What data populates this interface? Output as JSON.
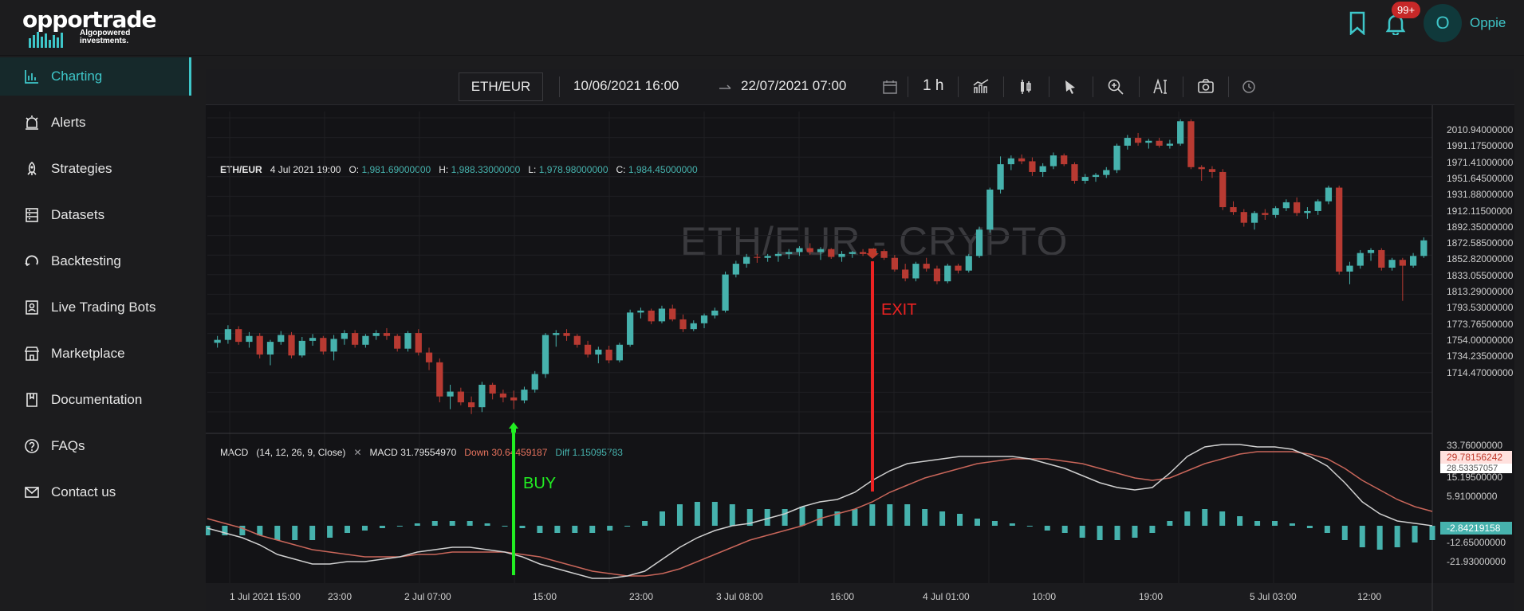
{
  "brand": {
    "name": "opportrade",
    "tagline_line1": "Algopowered",
    "tagline_line2": "investments."
  },
  "header": {
    "notification_count": "99+",
    "avatar_initial": "O",
    "username": "Oppie"
  },
  "sidebar": {
    "items": [
      {
        "label": "Charting",
        "icon": "chart-icon",
        "active": true
      },
      {
        "label": "Alerts",
        "icon": "alarm-icon",
        "active": false
      },
      {
        "label": "Strategies",
        "icon": "rocket-icon",
        "active": false
      },
      {
        "label": "Datasets",
        "icon": "database-icon",
        "active": false
      },
      {
        "label": "Backtesting",
        "icon": "history-icon",
        "active": false
      },
      {
        "label": "Live Trading Bots",
        "icon": "bot-icon",
        "active": false
      },
      {
        "label": "Marketplace",
        "icon": "store-icon",
        "active": false
      },
      {
        "label": "Documentation",
        "icon": "document-icon",
        "active": false
      },
      {
        "label": "FAQs",
        "icon": "question-icon",
        "active": false
      },
      {
        "label": "Contact us",
        "icon": "mail-icon",
        "active": false
      }
    ]
  },
  "toolbar": {
    "symbol": "ETH/EUR",
    "start_date": "10/06/2021 16:00",
    "end_date": "22/07/2021 07:00",
    "interval": "1 h"
  },
  "chart": {
    "watermark": "ETH/EUR - CRYPTO",
    "ohlc": {
      "symbol": "ETH/EUR",
      "time": "4 Jul 2021 19:00",
      "o_label": "O:",
      "o": "1,981.69000000",
      "h_label": "H:",
      "h": "1,988.33000000",
      "l_label": "L:",
      "l": "1,978.98000000",
      "c_label": "C:",
      "c": "1,984.45000000"
    },
    "macd_legend": {
      "name": "MACD",
      "params": "(14, 12, 26, 9, Close)",
      "macd_label": "MACD",
      "macd_value": "31.79554970",
      "down_label": "Down",
      "down_value": "30.64459187",
      "diff_label": "Diff",
      "diff_value": "1.15095783"
    },
    "annotations": {
      "buy": "BUY",
      "exit": "EXIT"
    },
    "price_ticks": [
      "2010.94000000",
      "1991.17500000",
      "1971.41000000",
      "1951.64500000",
      "1931.88000000",
      "1912.11500000",
      "1892.35000000",
      "1872.58500000",
      "1852.82000000",
      "1833.05500000",
      "1813.29000000",
      "1793.53000000",
      "1773.76500000",
      "1754.00000000",
      "1734.23500000",
      "1714.47000000"
    ],
    "macd_ticks": [
      "33.76000000",
      "15.19500000",
      "5.91000000",
      "-12.65000000",
      "-21.93000000"
    ],
    "macd_tags": {
      "macd": "29.78156242",
      "signal": "28.53357057",
      "hist": "-2.84219158"
    },
    "time_ticks": [
      "1 Jul 2021 15:00",
      "23:00",
      "2 Jul 07:00",
      "15:00",
      "23:00",
      "3 Jul 08:00",
      "16:00",
      "4 Jul 01:00",
      "10:00",
      "19:00",
      "5 Jul 03:00",
      "12:00"
    ],
    "colors": {
      "up": "#46b2ad",
      "down": "#b83a32",
      "macd_line": "#d0d0d0",
      "signal_line": "#c9665a",
      "buy_marker": "#22ee22",
      "exit_marker": "#ee2222"
    }
  },
  "chart_data": {
    "type": "candlestick",
    "title": "",
    "xlabel": "",
    "ylabel": "",
    "ylim": [
      1700,
      2020
    ],
    "candles": [
      [
        1783,
        1790,
        1778,
        1786
      ],
      [
        1786,
        1801,
        1782,
        1797
      ],
      [
        1797,
        1800,
        1781,
        1784
      ],
      [
        1784,
        1794,
        1778,
        1790
      ],
      [
        1790,
        1793,
        1767,
        1771
      ],
      [
        1771,
        1786,
        1760,
        1784
      ],
      [
        1784,
        1795,
        1781,
        1791
      ],
      [
        1791,
        1794,
        1767,
        1770
      ],
      [
        1770,
        1789,
        1768,
        1785
      ],
      [
        1785,
        1792,
        1780,
        1788
      ],
      [
        1788,
        1790,
        1771,
        1774
      ],
      [
        1774,
        1791,
        1765,
        1787
      ],
      [
        1787,
        1796,
        1781,
        1793
      ],
      [
        1793,
        1796,
        1778,
        1781
      ],
      [
        1781,
        1792,
        1778,
        1790
      ],
      [
        1790,
        1796,
        1786,
        1793
      ],
      [
        1793,
        1798,
        1786,
        1790
      ],
      [
        1790,
        1792,
        1774,
        1777
      ],
      [
        1777,
        1795,
        1774,
        1793
      ],
      [
        1793,
        1797,
        1770,
        1773
      ],
      [
        1773,
        1778,
        1755,
        1763
      ],
      [
        1763,
        1767,
        1722,
        1728
      ],
      [
        1728,
        1740,
        1715,
        1733
      ],
      [
        1733,
        1737,
        1719,
        1722
      ],
      [
        1722,
        1728,
        1710,
        1717
      ],
      [
        1717,
        1743,
        1712,
        1740
      ],
      [
        1740,
        1742,
        1725,
        1731
      ],
      [
        1731,
        1735,
        1722,
        1727
      ],
      [
        1727,
        1734,
        1715,
        1724
      ],
      [
        1724,
        1738,
        1721,
        1735
      ],
      [
        1735,
        1754,
        1732,
        1751
      ],
      [
        1751,
        1793,
        1747,
        1791
      ],
      [
        1791,
        1796,
        1779,
        1793
      ],
      [
        1793,
        1797,
        1785,
        1790
      ],
      [
        1790,
        1792,
        1778,
        1781
      ],
      [
        1781,
        1785,
        1768,
        1771
      ],
      [
        1771,
        1779,
        1762,
        1776
      ],
      [
        1776,
        1780,
        1762,
        1765
      ],
      [
        1765,
        1783,
        1763,
        1781
      ],
      [
        1781,
        1817,
        1779,
        1814
      ],
      [
        1814,
        1819,
        1808,
        1816
      ],
      [
        1816,
        1818,
        1802,
        1805
      ],
      [
        1805,
        1821,
        1803,
        1818
      ],
      [
        1818,
        1822,
        1805,
        1807
      ],
      [
        1807,
        1812,
        1794,
        1797
      ],
      [
        1797,
        1806,
        1795,
        1803
      ],
      [
        1803,
        1813,
        1798,
        1811
      ],
      [
        1811,
        1819,
        1808,
        1816
      ],
      [
        1816,
        1856,
        1814,
        1853
      ],
      [
        1853,
        1867,
        1850,
        1864
      ],
      [
        1864,
        1874,
        1860,
        1871
      ],
      [
        1871,
        1874,
        1865,
        1870
      ],
      [
        1870,
        1874,
        1866,
        1872
      ],
      [
        1872,
        1876,
        1866,
        1874
      ],
      [
        1874,
        1879,
        1869,
        1876
      ],
      [
        1876,
        1882,
        1872,
        1880
      ],
      [
        1880,
        1885,
        1873,
        1876
      ],
      [
        1876,
        1881,
        1868,
        1879
      ],
      [
        1879,
        1880,
        1869,
        1871
      ],
      [
        1871,
        1877,
        1866,
        1874
      ],
      [
        1874,
        1877,
        1870,
        1876
      ],
      [
        1876,
        1879,
        1872,
        1874
      ],
      [
        1874,
        1880,
        1872,
        1877
      ],
      [
        1877,
        1879,
        1868,
        1870
      ],
      [
        1870,
        1873,
        1856,
        1858
      ],
      [
        1858,
        1864,
        1846,
        1849
      ],
      [
        1849,
        1866,
        1846,
        1864
      ],
      [
        1864,
        1870,
        1856,
        1859
      ],
      [
        1859,
        1862,
        1843,
        1846
      ],
      [
        1846,
        1864,
        1844,
        1862
      ],
      [
        1862,
        1864,
        1854,
        1857
      ],
      [
        1857,
        1874,
        1855,
        1872
      ],
      [
        1872,
        1902,
        1870,
        1899
      ],
      [
        1899,
        1942,
        1896,
        1940
      ],
      [
        1940,
        1974,
        1936,
        1966
      ],
      [
        1966,
        1975,
        1960,
        1972
      ],
      [
        1972,
        1976,
        1966,
        1969
      ],
      [
        1969,
        1973,
        1954,
        1958
      ],
      [
        1958,
        1967,
        1953,
        1964
      ],
      [
        1964,
        1978,
        1961,
        1975
      ],
      [
        1975,
        1977,
        1964,
        1966
      ],
      [
        1966,
        1968,
        1946,
        1949
      ],
      [
        1949,
        1956,
        1946,
        1953
      ],
      [
        1953,
        1957,
        1948,
        1955
      ],
      [
        1955,
        1963,
        1952,
        1960
      ],
      [
        1960,
        1987,
        1957,
        1985
      ],
      [
        1985,
        1996,
        1981,
        1993
      ],
      [
        1993,
        1998,
        1985,
        1988
      ],
      [
        1988,
        1992,
        1982,
        1990
      ],
      [
        1990,
        1993,
        1983,
        1985
      ],
      [
        1985,
        1991,
        1982,
        1987
      ],
      [
        1987,
        2012,
        1985,
        2010
      ],
      [
        2010,
        2012,
        1961,
        1963
      ],
      [
        1963,
        1965,
        1949,
        1961
      ],
      [
        1961,
        1964,
        1952,
        1958
      ],
      [
        1958,
        1961,
        1919,
        1922
      ],
      [
        1922,
        1928,
        1914,
        1917
      ],
      [
        1917,
        1920,
        1902,
        1906
      ],
      [
        1906,
        1918,
        1899,
        1916
      ],
      [
        1916,
        1920,
        1909,
        1914
      ],
      [
        1914,
        1923,
        1911,
        1921
      ],
      [
        1921,
        1930,
        1918,
        1927
      ],
      [
        1927,
        1932,
        1913,
        1916
      ],
      [
        1916,
        1922,
        1910,
        1918
      ],
      [
        1918,
        1930,
        1914,
        1928
      ],
      [
        1928,
        1944,
        1925,
        1942
      ],
      [
        1942,
        1944,
        1853,
        1856
      ],
      [
        1856,
        1866,
        1843,
        1862
      ],
      [
        1862,
        1878,
        1859,
        1875
      ],
      [
        1875,
        1880,
        1867,
        1878
      ],
      [
        1878,
        1880,
        1857,
        1860
      ],
      [
        1860,
        1870,
        1857,
        1868
      ],
      [
        1868,
        1870,
        1826,
        1862
      ],
      [
        1862,
        1875,
        1860,
        1872
      ],
      [
        1872,
        1891,
        1870,
        1888
      ]
    ],
    "macd": [
      -1,
      -3,
      -5,
      -8,
      -12,
      -14,
      -16,
      -16,
      -15,
      -15,
      -14,
      -13,
      -11,
      -10,
      -9,
      -9,
      -10,
      -11,
      -13,
      -16,
      -18,
      -20,
      -22,
      -22,
      -21,
      -19,
      -14,
      -9,
      -5,
      -2,
      0,
      1,
      3,
      5,
      8,
      10,
      11,
      14,
      19,
      23,
      26,
      27,
      28,
      29,
      29,
      29,
      29,
      28,
      26,
      24,
      21,
      18,
      16,
      15,
      16,
      22,
      29,
      33,
      34,
      34,
      33,
      33,
      32,
      29,
      25,
      18,
      10,
      5,
      2,
      1,
      0
    ],
    "signal": [
      3,
      1,
      -1,
      -4,
      -6,
      -8,
      -10,
      -11,
      -12,
      -13,
      -13,
      -13,
      -12,
      -12,
      -11,
      -11,
      -11,
      -11,
      -12,
      -13,
      -15,
      -17,
      -19,
      -20,
      -21,
      -21,
      -20,
      -18,
      -15,
      -12,
      -9,
      -6,
      -4,
      -2,
      0,
      3,
      5,
      7,
      10,
      14,
      17,
      20,
      22,
      24,
      26,
      27,
      28,
      28,
      28,
      27,
      26,
      24,
      22,
      20,
      19,
      20,
      23,
      26,
      28,
      30,
      31,
      31,
      31,
      30,
      28,
      24,
      19,
      15,
      11,
      8,
      6
    ],
    "histogram": [
      -4,
      -4,
      -4,
      -4,
      -6,
      -6,
      -6,
      -5,
      -3,
      -2,
      -1,
      0,
      1,
      2,
      2,
      2,
      1,
      0,
      -1,
      -3,
      -3,
      -3,
      -3,
      -2,
      0,
      2,
      6,
      9,
      10,
      10,
      9,
      7,
      7,
      7,
      8,
      7,
      6,
      7,
      9,
      9,
      9,
      7,
      6,
      5,
      3,
      2,
      1,
      0,
      -2,
      -3,
      -5,
      -6,
      -6,
      -5,
      -3,
      2,
      6,
      7,
      6,
      4,
      2,
      2,
      1,
      -1,
      -3,
      -6,
      -9,
      -10,
      -9,
      -7,
      -6
    ]
  }
}
